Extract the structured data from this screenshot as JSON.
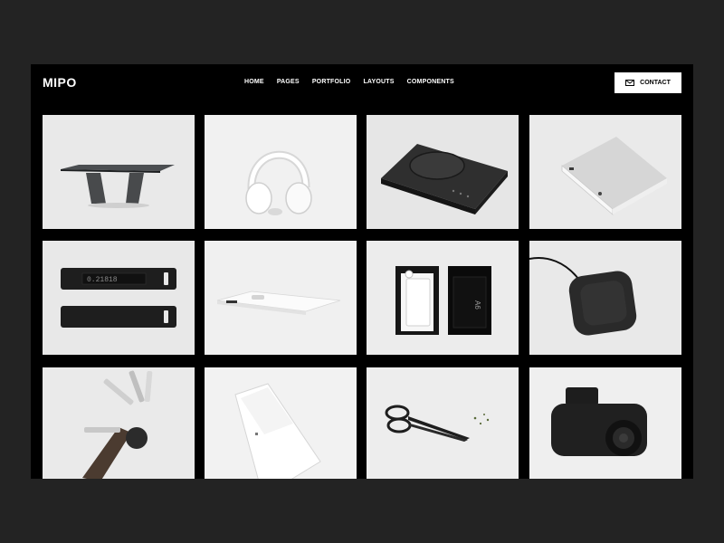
{
  "header": {
    "logo": "MIPO",
    "nav": [
      "HOME",
      "PAGES",
      "PORTFOLIO",
      "LAYOUTS",
      "COMPONENTS"
    ],
    "contact_label": "CONTACT",
    "contact_icon": "envelope-icon"
  },
  "device_display": "0.21818",
  "notebook_label": "A6",
  "colors": {
    "page_bg": "#232323",
    "site_bg": "#000000",
    "tile_bg": "#ececec",
    "button_bg": "#ffffff"
  }
}
